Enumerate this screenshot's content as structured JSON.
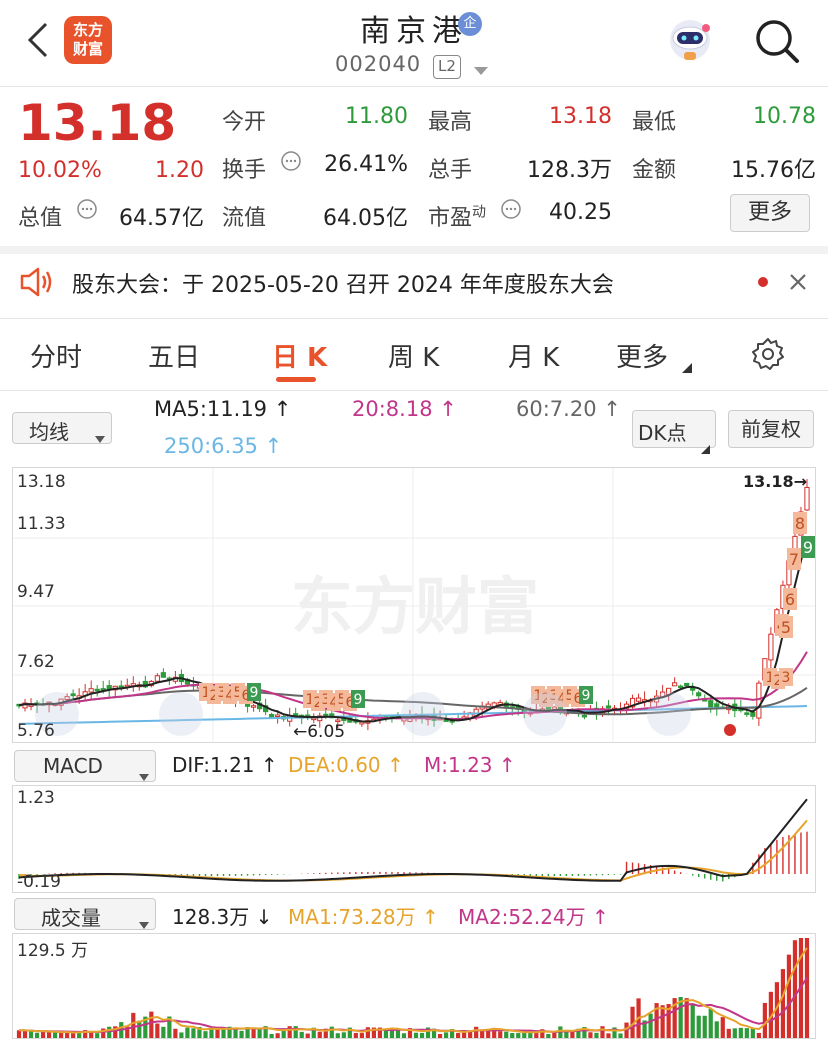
{
  "header": {
    "logo_text_1": "东方",
    "logo_text_2": "财富",
    "title": "南京港",
    "corp_badge": "企",
    "code": "002040",
    "level_badge": "L2"
  },
  "quote": {
    "price": "13.18",
    "change_pct": "10.02%",
    "change_amt": "1.20",
    "open_label": "今开",
    "open": "11.80",
    "high_label": "最高",
    "high": "13.18",
    "low_label": "最低",
    "low": "10.78",
    "turnover_label": "换手",
    "turnover": "26.41%",
    "volume_label": "总手",
    "volume": "128.3万",
    "amount_label": "金额",
    "amount": "15.76亿",
    "mktcap_label": "总值",
    "mktcap": "64.57亿",
    "float_label": "流值",
    "float_cap": "64.05亿",
    "pe_label": "市盈",
    "pe_sup": "动",
    "pe": "40.25",
    "more_label": "更多"
  },
  "notice": {
    "text": "股东大会：于 2025-05-20 召开 2024 年年度股东大会"
  },
  "tabs": [
    {
      "label": "分时"
    },
    {
      "label": "五日"
    },
    {
      "label": "日 K"
    },
    {
      "label": "周 K"
    },
    {
      "label": "月 K"
    },
    {
      "label": "更多"
    }
  ],
  "active_tab": "日 K",
  "ma_bar": {
    "select_label": "均线",
    "ma5": "MA5:11.19 ↑",
    "ma20": "20:8.18 ↑",
    "ma60": "60:7.20 ↑",
    "ma250": "250:6.35 ↑",
    "dk_label": "DK点",
    "fq_label": "前复权"
  },
  "kline": {
    "y_labels": [
      "13.18",
      "11.33",
      "9.47",
      "7.62",
      "5.76"
    ],
    "last_price_label": "13.18→",
    "low_marker": "←6.05",
    "watermark": "东方财富"
  },
  "macd_bar": {
    "select_label": "MACD",
    "dif": "DIF:1.21 ↑",
    "dea": "DEA:0.60 ↑",
    "m": "M:1.23 ↑",
    "y_top": "1.23",
    "y_bottom": "-0.19"
  },
  "vol_bar": {
    "select_label": "成交量",
    "vol": "128.3万 ↓",
    "ma1": "MA1:73.28万 ↑",
    "ma2": "MA2:52.24万 ↑",
    "y_top": "129.5 万"
  },
  "colors": {
    "up": "#d4302b",
    "down": "#2e9b3a",
    "ma5": "#222222",
    "ma20": "#c2368a",
    "ma60": "#666666",
    "ma250": "#6ab7e6",
    "dea": "#e6a42c",
    "accent": "#e8532c"
  }
}
